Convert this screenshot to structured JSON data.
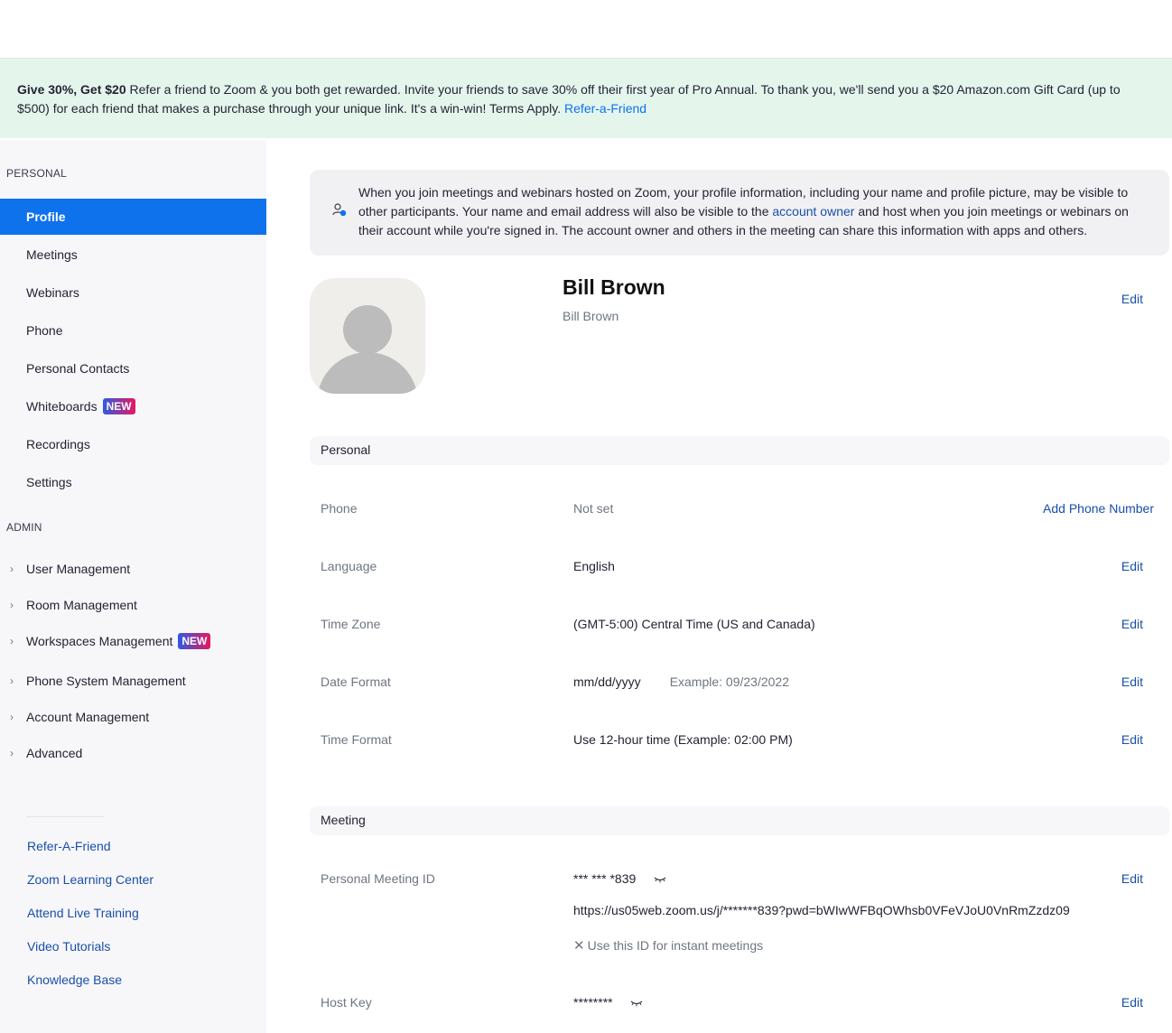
{
  "banner": {
    "bold": "Give 30%, Get $20",
    "text": " Refer a friend to Zoom & you both get rewarded. Invite your friends to save 30% off their first year of Pro Annual. To thank you, we'll send you a $20 Amazon.com Gift Card (up to $500) for each friend that makes a purchase through your unique link. It's a win-win! Terms Apply. ",
    "link": "Refer-a-Friend"
  },
  "sidebar": {
    "personal_heading": "PERSONAL",
    "personal_items": [
      {
        "label": "Profile"
      },
      {
        "label": "Meetings"
      },
      {
        "label": "Webinars"
      },
      {
        "label": "Phone"
      },
      {
        "label": "Personal Contacts"
      },
      {
        "label": "Whiteboards",
        "badge": "NEW"
      },
      {
        "label": "Recordings"
      },
      {
        "label": "Settings"
      }
    ],
    "admin_heading": "ADMIN",
    "admin_items": [
      {
        "label": "User Management"
      },
      {
        "label": "Room Management"
      },
      {
        "label": "Workspaces Management",
        "badge": "NEW"
      },
      {
        "label": "Phone System Management"
      },
      {
        "label": "Account Management"
      },
      {
        "label": "Advanced"
      }
    ],
    "links": [
      "Refer-A-Friend",
      "Zoom Learning Center",
      "Attend Live Training",
      "Video Tutorials",
      "Knowledge Base"
    ]
  },
  "notice": {
    "text_before": "When you join meetings and webinars hosted on Zoom, your profile information, including your name and profile picture, may be visible to other participants. Your name and email address will also be visible to the ",
    "link": "account owner",
    "text_after": " and host when you join meetings or webinars on their account while you're signed in. The account owner and others in the meeting can share this information with apps and others."
  },
  "profile": {
    "display_name": "Bill Brown",
    "sub_name": "Bill Brown",
    "edit": "Edit"
  },
  "personal": {
    "heading": "Personal",
    "phone_label": "Phone",
    "phone_value": "Not set",
    "phone_action": "Add Phone Number",
    "language_label": "Language",
    "language_value": "English",
    "timezone_label": "Time Zone",
    "timezone_value": "(GMT-5:00) Central Time (US and Canada)",
    "dateformat_label": "Date Format",
    "dateformat_value": "mm/dd/yyyy",
    "dateformat_example": "Example: 09/23/2022",
    "timeformat_label": "Time Format",
    "timeformat_value": "Use 12-hour time (Example: 02:00 PM)",
    "edit": "Edit"
  },
  "meeting": {
    "heading": "Meeting",
    "pmi_label": "Personal Meeting ID",
    "pmi_value": "*** *** *839",
    "pmi_url": "https://us05web.zoom.us/j/*******839?pwd=bWIwWFBqOWhsb0VFeVJoU0VnRmZzdz09",
    "instant_label": "Use this ID for instant meetings",
    "hostkey_label": "Host Key",
    "hostkey_value": "********",
    "edit": "Edit"
  },
  "colors": {
    "accent": "#0e72ed",
    "link": "#1a4fa8",
    "banner_bg": "#e4f5ec",
    "sidebar_bg": "#f7f7fa"
  }
}
